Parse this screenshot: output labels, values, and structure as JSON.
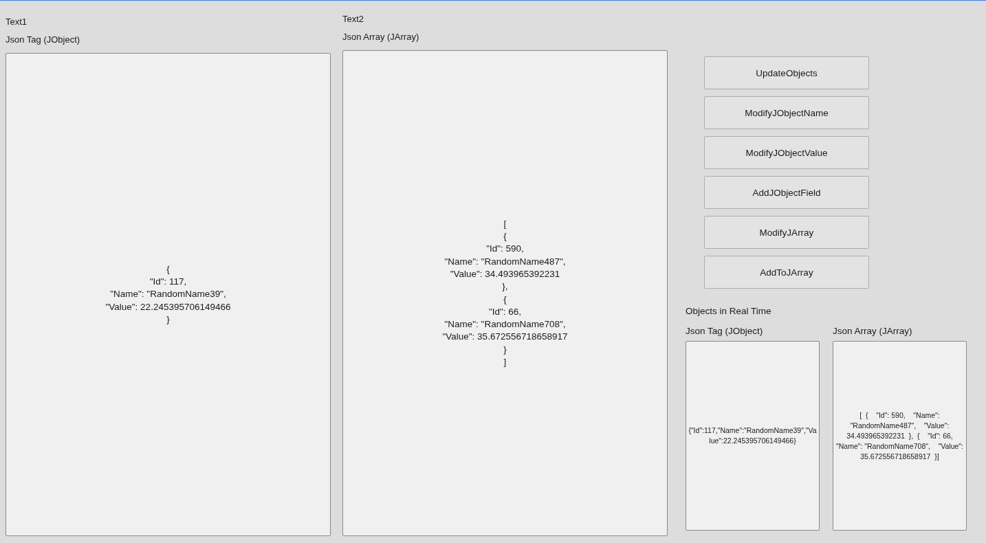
{
  "panels": [
    {
      "caption": "Text1",
      "label": "Json Tag (JObject)",
      "content": "{\n\"Id\": 117,\n\"Name\": \"RandomName39\",\n\"Value\": 22.245395706149466\n}"
    },
    {
      "caption": "Text2",
      "label": "Json Array (JArray)",
      "content": "[\n{\n\"Id\": 590,\n\"Name\": \"RandomName487\",\n\"Value\": 34.493965392231\n},\n{\n\"Id\": 66,\n\"Name\": \"RandomName708\",\n\"Value\": 35.672556718658917\n}\n]"
    }
  ],
  "buttons": [
    "UpdateObjects",
    "ModifyJObjectName",
    "ModifyJObjectValue",
    "AddJObjectField",
    "ModifyJArray",
    "AddToJArray"
  ],
  "realtime": {
    "title": "Objects in Real Time",
    "panels": [
      {
        "label": "Json Tag (JObject)",
        "content": "{\"Id\":117,\"Name\":\"RandomName39\",\"Value\":22.245395706149466}"
      },
      {
        "label": "Json Array (JArray)",
        "content": "[  {    \"Id\": 590,    \"Name\": \"RandomName487\",    \"Value\": 34.493965392231  },  {    \"Id\": 66,    \"Name\": \"RandomName708\",    \"Value\": 35.672556718658917  }]"
      }
    ]
  }
}
